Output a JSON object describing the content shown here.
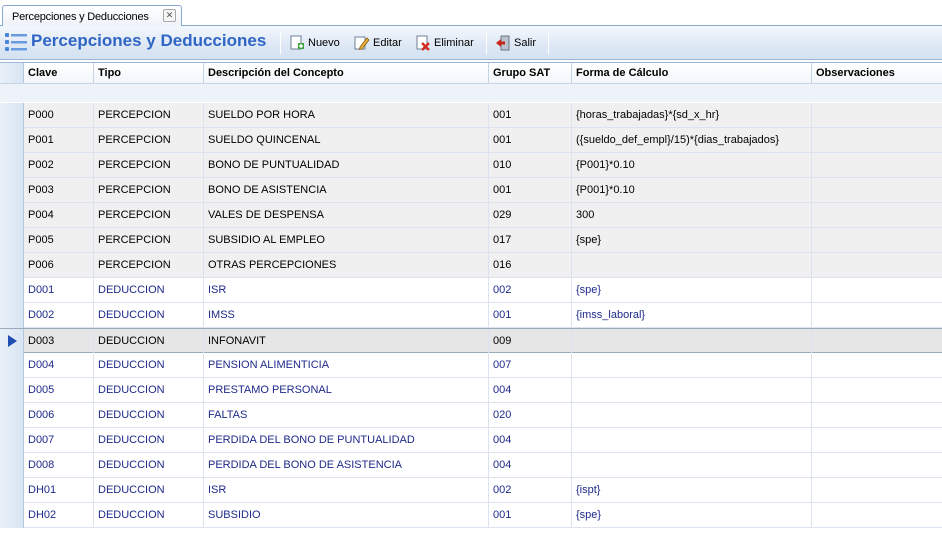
{
  "tab": {
    "label": "Percepciones y Deducciones",
    "close_glyph": "✕"
  },
  "toolbar": {
    "title": "Percepciones y Deducciones",
    "title_icon": "list-icon",
    "buttons": [
      {
        "label": "Nuevo",
        "icon": "new-document-icon"
      },
      {
        "label": "Editar",
        "icon": "edit-pencil-icon"
      },
      {
        "label": "Eliminar",
        "icon": "delete-icon"
      },
      {
        "label": "Salir",
        "icon": "exit-door-icon"
      }
    ]
  },
  "grid": {
    "columns": [
      "Clave",
      "Tipo",
      "Descripción del Concepto",
      "Grupo SAT",
      "Forma de Cálculo",
      "Observaciones"
    ],
    "selected_index": 9,
    "rows": [
      {
        "clave": "P000",
        "tipo": "PERCEPCION",
        "descripcion": "SUELDO POR HORA",
        "grupo": "001",
        "forma": "{horas_trabajadas}*{sd_x_hr}",
        "obs": ""
      },
      {
        "clave": "P001",
        "tipo": "PERCEPCION",
        "descripcion": "SUELDO QUINCENAL",
        "grupo": "001",
        "forma": "({sueldo_def_empl}/15)*{dias_trabajados}",
        "obs": ""
      },
      {
        "clave": "P002",
        "tipo": "PERCEPCION",
        "descripcion": "BONO DE PUNTUALIDAD",
        "grupo": "010",
        "forma": "{P001}*0.10",
        "obs": ""
      },
      {
        "clave": "P003",
        "tipo": "PERCEPCION",
        "descripcion": "BONO DE ASISTENCIA",
        "grupo": "001",
        "forma": "{P001}*0.10",
        "obs": ""
      },
      {
        "clave": "P004",
        "tipo": "PERCEPCION",
        "descripcion": "VALES DE DESPENSA",
        "grupo": "029",
        "forma": "300",
        "obs": ""
      },
      {
        "clave": "P005",
        "tipo": "PERCEPCION",
        "descripcion": "SUBSIDIO AL EMPLEO",
        "grupo": "017",
        "forma": "{spe}",
        "obs": ""
      },
      {
        "clave": "P006",
        "tipo": "PERCEPCION",
        "descripcion": "OTRAS PERCEPCIONES",
        "grupo": "016",
        "forma": "",
        "obs": ""
      },
      {
        "clave": "D001",
        "tipo": "DEDUCCION",
        "descripcion": "ISR",
        "grupo": "002",
        "forma": "{spe}",
        "obs": ""
      },
      {
        "clave": "D002",
        "tipo": "DEDUCCION",
        "descripcion": "IMSS",
        "grupo": "001",
        "forma": "{imss_laboral}",
        "obs": ""
      },
      {
        "clave": "D003",
        "tipo": "DEDUCCION",
        "descripcion": "INFONAVIT",
        "grupo": "009",
        "forma": "",
        "obs": ""
      },
      {
        "clave": "D004",
        "tipo": "DEDUCCION",
        "descripcion": "PENSION ALIMENTICIA",
        "grupo": "007",
        "forma": "",
        "obs": ""
      },
      {
        "clave": "D005",
        "tipo": "DEDUCCION",
        "descripcion": "PRESTAMO PERSONAL",
        "grupo": "004",
        "forma": "",
        "obs": ""
      },
      {
        "clave": "D006",
        "tipo": "DEDUCCION",
        "descripcion": "FALTAS",
        "grupo": "020",
        "forma": "",
        "obs": ""
      },
      {
        "clave": "D007",
        "tipo": "DEDUCCION",
        "descripcion": "PERDIDA DEL BONO DE PUNTUALIDAD",
        "grupo": "004",
        "forma": "",
        "obs": ""
      },
      {
        "clave": "D008",
        "tipo": "DEDUCCION",
        "descripcion": "PERDIDA DEL BONO DE ASISTENCIA",
        "grupo": "004",
        "forma": "",
        "obs": ""
      },
      {
        "clave": "DH01",
        "tipo": "DEDUCCION",
        "descripcion": "ISR",
        "grupo": "002",
        "forma": "{ispt}",
        "obs": ""
      },
      {
        "clave": "DH02",
        "tipo": "DEDUCCION",
        "descripcion": "SUBSIDIO",
        "grupo": "001",
        "forma": "{spe}",
        "obs": ""
      }
    ]
  },
  "colors": {
    "title_blue": "#2f65c5",
    "deduccion_text": "#1e2a8a",
    "percepcion_row_bg": "#f0f0f0",
    "selected_row_bg": "#e6e6e6",
    "row_indicator": "#1f4fb0"
  }
}
